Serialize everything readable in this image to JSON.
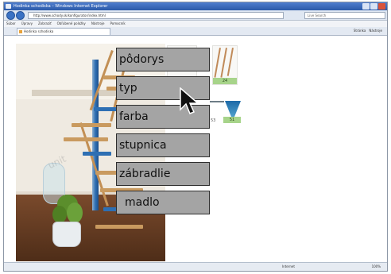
{
  "window": {
    "title": "Hodinka schodiska – Windows Internet Explorer"
  },
  "address": {
    "url": "http://www.schody.sk/konfigurator/index.html",
    "search_engine": "Live Search"
  },
  "menubar": {
    "items": [
      "Súbor",
      "Úpravy",
      "Zobraziť",
      "Obľúbené položky",
      "Nástroje",
      "Pomocník"
    ]
  },
  "tab": {
    "label": "Hodinka schodiska"
  },
  "commandbar": {
    "items": [
      "Stránka",
      "Nástroje"
    ]
  },
  "thumbnails": {
    "labels": [
      "24",
      "51"
    ],
    "side_number": "53"
  },
  "watermark": "unit",
  "menu": {
    "items": [
      {
        "label": "pôdorys",
        "id": "podorys"
      },
      {
        "label": "typ",
        "id": "typ"
      },
      {
        "label": "farba",
        "id": "farba"
      },
      {
        "label": "stupnica",
        "id": "stupnica"
      },
      {
        "label": "zábradlie",
        "id": "zabradlie"
      },
      {
        "label": "madlo",
        "id": "madlo"
      }
    ]
  },
  "status": {
    "zone": "Internet",
    "zoom": "100%"
  },
  "colors": {
    "menu_bg": "#a4a4a4",
    "stair_blue": "#2e6fb3",
    "wood": "#c99a5f",
    "thumb_label_bg": "#a7d48a"
  }
}
